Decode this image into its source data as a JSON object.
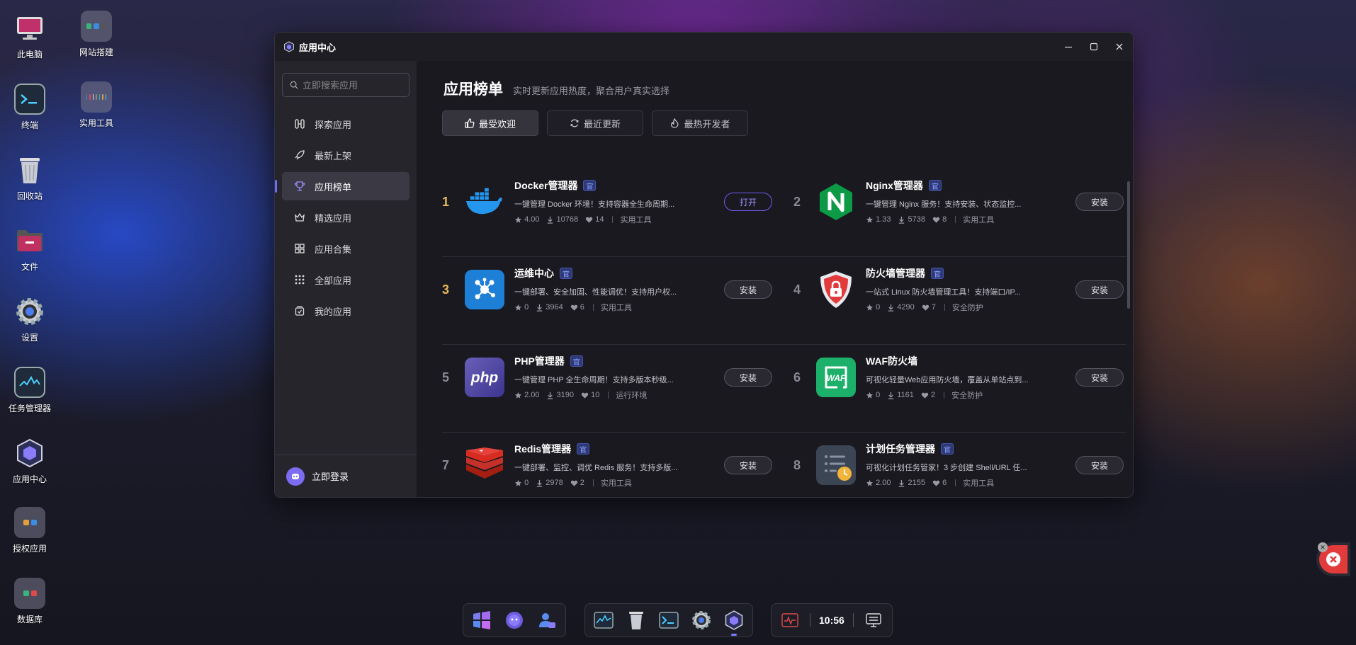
{
  "desktop": {
    "icons": [
      {
        "label": "此电脑"
      },
      {
        "label": "网站搭建"
      },
      {
        "label": "终端"
      },
      {
        "label": "实用工具"
      },
      {
        "label": "回收站"
      },
      {
        "label": "文件"
      },
      {
        "label": "设置"
      },
      {
        "label": "任务管理器"
      },
      {
        "label": "应用中心"
      },
      {
        "label": "授权应用"
      },
      {
        "label": "数据库"
      }
    ]
  },
  "window": {
    "title": "应用中心",
    "controls": {
      "minimize": "—",
      "maximize": "☐",
      "close": "✕"
    }
  },
  "sidebar": {
    "search_placeholder": "立即搜索应用",
    "items": [
      {
        "label": "探索应用",
        "icon": "explore-icon"
      },
      {
        "label": "最新上架",
        "icon": "rocket-icon"
      },
      {
        "label": "应用榜单",
        "icon": "trophy-icon",
        "active": true
      },
      {
        "label": "精选应用",
        "icon": "crown-icon"
      },
      {
        "label": "应用合集",
        "icon": "grid-icon"
      },
      {
        "label": "全部应用",
        "icon": "dots-grid-icon"
      },
      {
        "label": "我的应用",
        "icon": "my-apps-icon"
      }
    ],
    "login_label": "立即登录"
  },
  "main": {
    "title": "应用榜单",
    "subtitle": "实时更新应用热度，聚合用户真实选择",
    "tabs": [
      {
        "label": "最受欢迎",
        "icon": "thumbs-up-icon",
        "active": true
      },
      {
        "label": "最近更新",
        "icon": "refresh-icon"
      },
      {
        "label": "最热开发者",
        "icon": "fire-icon"
      }
    ],
    "official_badge": "官",
    "apps": [
      {
        "rank": "1",
        "name": "Docker管理器",
        "desc": "一键管理 Docker 环境！支持容器全生命周期...",
        "rating": "4.00",
        "downloads": "10768",
        "likes": "14",
        "category": "实用工具",
        "button": "打开"
      },
      {
        "rank": "2",
        "name": "Nginx管理器",
        "desc": "一键管理 Nginx 服务！支持安装、状态监控...",
        "rating": "1.33",
        "downloads": "5738",
        "likes": "8",
        "category": "实用工具",
        "button": "安装"
      },
      {
        "rank": "3",
        "name": "运维中心",
        "desc": "一键部署、安全加固、性能调优！支持用户权...",
        "rating": "0",
        "downloads": "3964",
        "likes": "6",
        "category": "实用工具",
        "button": "安装"
      },
      {
        "rank": "4",
        "name": "防火墙管理器",
        "desc": "一站式 Linux 防火墙管理工具！支持端口/IP...",
        "rating": "0",
        "downloads": "4290",
        "likes": "7",
        "category": "安全防护",
        "button": "安装"
      },
      {
        "rank": "5",
        "name": "PHP管理器",
        "desc": "一键管理 PHP 全生命周期！支持多版本秒级...",
        "rating": "2.00",
        "downloads": "3190",
        "likes": "10",
        "category": "运行环境",
        "button": "安装"
      },
      {
        "rank": "6",
        "name": "WAF防火墙",
        "desc": "可视化轻量Web应用防火墙，覆盖从单站点到...",
        "rating": "0",
        "downloads": "1161",
        "likes": "2",
        "category": "安全防护",
        "button": "安装"
      },
      {
        "rank": "7",
        "name": "Redis管理器",
        "desc": "一键部署、监控、调优 Redis 服务！支持多版...",
        "rating": "0",
        "downloads": "2978",
        "likes": "2",
        "category": "实用工具",
        "button": "安装"
      },
      {
        "rank": "8",
        "name": "计划任务管理器",
        "desc": "可视化计划任务管家！3 步创建 Shell/URL 任...",
        "rating": "2.00",
        "downloads": "2155",
        "likes": "6",
        "category": "实用工具",
        "button": "安装"
      }
    ]
  },
  "taskbar": {
    "clock": "10:56"
  },
  "colors": {
    "accent": "#6c6cff",
    "rank_top": "#e7b75a",
    "window_bg": "#1e1d24",
    "sidebar_bg": "#26252c"
  }
}
